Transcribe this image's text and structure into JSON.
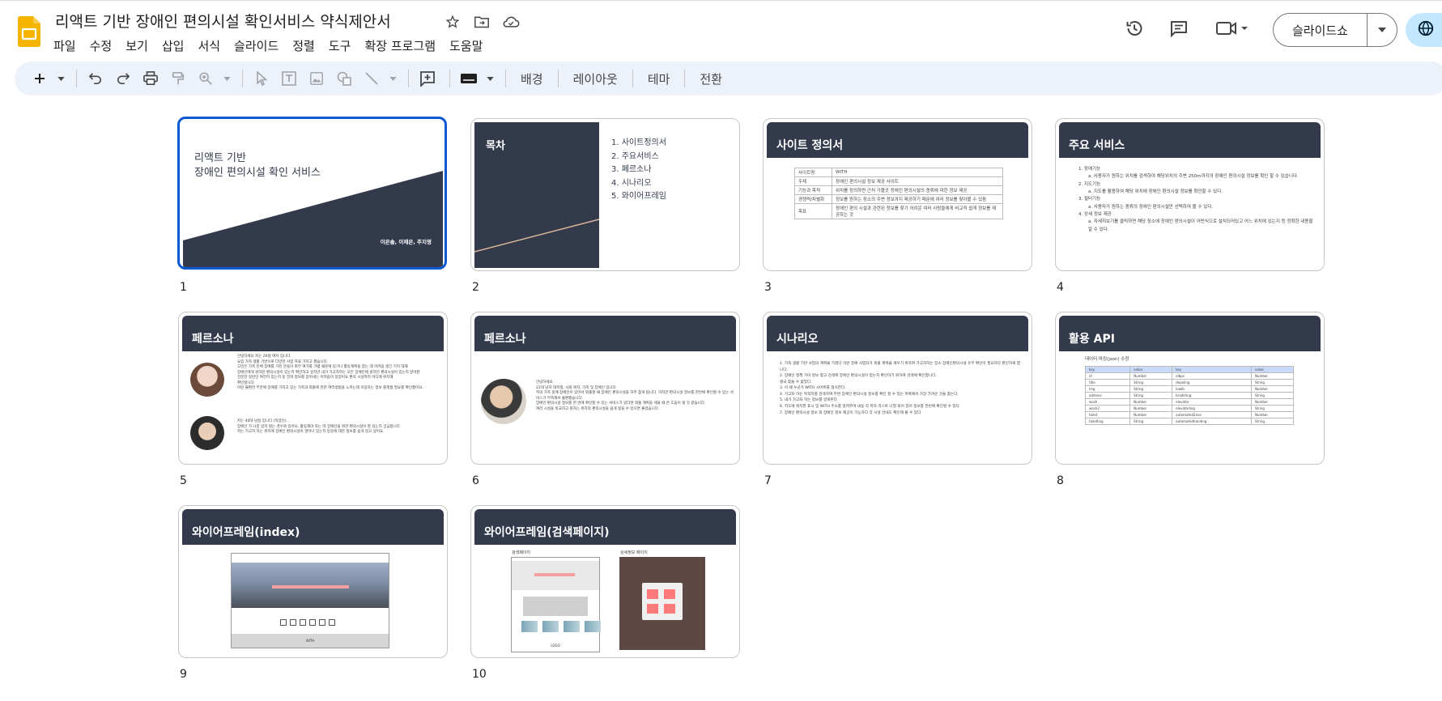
{
  "document": {
    "title": "리액트 기반 장애인 편의시설 확인서비스 약식제안서"
  },
  "menu": [
    "파일",
    "수정",
    "보기",
    "삽입",
    "서식",
    "슬라이드",
    "정렬",
    "도구",
    "확장 프로그램",
    "도움말"
  ],
  "header_buttons": {
    "slideshow_label": "슬라이드쇼"
  },
  "toolbar": {
    "background_label": "배경",
    "layout_label": "레이아웃",
    "theme_label": "테마",
    "transition_label": "전환"
  },
  "colors": {
    "accent": "#0b57d0",
    "slide_band": "#323a4c",
    "toolbar_bg": "#edf2fa",
    "share_bg": "#c2e7ff",
    "logo": "#f5b400"
  },
  "slides": [
    {
      "number": "1",
      "title_line1": "리액트 기반",
      "title_line2": "장애인 편의시설 확인 서비스",
      "authors": "이은솔, 이재은, 주지영"
    },
    {
      "number": "2",
      "title": "목차",
      "items": [
        "1.   사이트정의서",
        "2.   주요서비스",
        "3.   페르소나",
        "4.   시나리오",
        "5.   와이어프레임"
      ]
    },
    {
      "number": "3",
      "title": "사이트 정의서",
      "table": [
        [
          "사이트명",
          "WITH"
        ],
        [
          "주제",
          "장애인 편의시설 정보 제공 사이트"
        ],
        [
          "기능과 목적",
          "위치를 정의하면 근처 가볼곳 장애인 편의시설의 종류에 대한 정보 제공"
        ],
        [
          "경쟁력/차별화",
          "정보를 원하는 장소의 주변 정보까지 제공하기 때문에 여러 정보를 찾아볼 수 있음"
        ],
        [
          "목표",
          "장애인 편의 시설과 관련된 정보를 찾기 어려운 여러 사람들에게 비교적 쉽게 정보를 제공하는 것"
        ]
      ]
    },
    {
      "number": "4",
      "title": "주요 서비스",
      "lines": [
        "1.   장애기능",
        "a.   사용자가 원하는 위치를 검색하여 해당위치의 주변 250m까지의 장애인 편의시설 정보를 확인 할 수 있습니다.",
        "2.   지도기능",
        "a.   지도를 활용하여 해당 위치에 장애인 편의시설 정보를 확인할 수 있다.",
        "3.   필터기능",
        "a.   사용자가 원하는 종류의 장애인 편의시설만 선택하여 볼 수 있다.",
        "4.   상세 정보 제공",
        "a.   자세히보기를 클릭하면 해당 장소에 장애인 편의시설이 어떤식으로 설치되어있고 어느 위치에 있는지 등 정확한 내용을 알 수 있다."
      ]
    },
    {
      "number": "5",
      "title": "페르소나",
      "p1": [
        "안녕하세요 저는 26살 여자 입니다.",
        "요즘 가족 생활 기반으로 다양한 사업 자료 가지고 했습니다.",
        "고민은 가족 전체 장애를 가진 분들이 외부 여가를 가볍 때문에 있기나 활동계획을 잡는 데 어려움 생긴 기억 대해",
        "장애인에게 원하던 편의시설이 있는지 확인하고 싶지만 내가 가고자하는 모든 장애인에 원하던 편의시설이 있는지 알아본",
        "친분한 일반인 여전히 있는지 등 전혀 정보를 얻어내는 어려움이 있었어요 편의 시설까지 어디에 위치해",
        "확인합니다.",
        "이런 불편한 부분에 장애를 가지고 있는 가족과 외출에 관한 여러방법을 느끼는데 이용하는 정보 플랫폼 필요를 확인했어요."
      ],
      "p2": [
        "저는 40대 남성 입니다 (직장인).",
        "장애인 가 나중 있지 않는 경우와 있어요, 활동해야 하는 데 장애인을 위한 편의시설이 잘 있는지 궁금합니다",
        "저는 가고자 하는 위치에 장애인 편의시설이 얼마나 있는지 등등에 대한 정보를 쉽게 알고 싶어요."
      ]
    },
    {
      "number": "6",
      "title": "페르소나",
      "p1": [
        "안녕하세요",
        "22대 남자 대학생, 사회 복지, 가족 및 장애인 입니다.",
        "저의 가족 중에 장애인이 있어서 외출할 때 장애인 편의시설을 자주 찾게 됩니다. 하지만 편의시설 정보를 한번에 확인할 수 있는 서비스가 부족해서 불편했습니다.",
        "장애인 편의시설 정보를 한 번에 확인할 수 있는 서비스가 있다면 외출 계획을 세울 때 큰 도움이 될 것 같습니다.",
        "여러 시설을 비교하고 원하는 위치의 편의시설을 쉽게 찾을 수 있으면 좋겠습니다."
      ]
    },
    {
      "number": "7",
      "title": "시나리오",
      "lines": [
        "1.   가족 생활 기반 사업의 계획을 가졌다 이런 장애 사업자가 외출 계획을 세우기 위하여 가고자하는 장소 장애인편의시설 유무 확인이 필요하다 판단하게 합니다.",
        "2.   장애인 정책 가이 정보 찾고 검색에 장애인 편의시설이 있는지 확인하기 위하여 검색에 확인합니다.",
        "      결국 찾을 수 없었다.",
        "3.   이 때 누군가 WITH 사이트를 접속한다.",
        "4.   가고자 하는 목적지를 검색하여 주변 장애인 편의시설 정보를 확인 할 수 있는 목록에서 가장 가까운 것을 찾는다.",
        "5.   내가 가고자 하는 정보를 알게된다.",
        "6.   지도에 위치한 표시 및 WITH 주소를 알려주며 내용 각 목차 리스트 나열 되어 있어 정보를 한번에 확인할 수 있다.",
        "7.   장애인 편의시설 정보 외 장애인 정보 제공이 가능하다 각 시설 안내도 확인해 볼 수 있다."
      ]
    },
    {
      "number": "8",
      "title": "활용 API",
      "caption": "데이터 마킹(json) 수정",
      "header": [
        "key",
        "value",
        "key",
        "value"
      ],
      "rows": [
        [
          "id",
          "Number",
          "elbpc",
          "Number"
        ],
        [
          "title",
          "String",
          "depoling",
          "String"
        ],
        [
          "img",
          "String",
          "lowlb",
          "Number"
        ],
        [
          "address",
          "String",
          "bradlrling",
          "String"
        ],
        [
          "wash",
          "Number",
          "elevator",
          "Number"
        ],
        [
          "wash2",
          "Number",
          "elevatorling",
          "String"
        ],
        [
          "toilet",
          "Number",
          "automated2ove",
          "Number"
        ],
        [
          "toiletling",
          "String",
          "automatedhanding",
          "String"
        ]
      ]
    },
    {
      "number": "9",
      "title": "와이어프레임(index)",
      "footer": "WITH"
    },
    {
      "number": "10",
      "title": "와이어프레임(검색페이지)",
      "left_caption": "검색페이지",
      "right_caption": "상세정보 페이지",
      "footer_left": "LOGO"
    }
  ]
}
